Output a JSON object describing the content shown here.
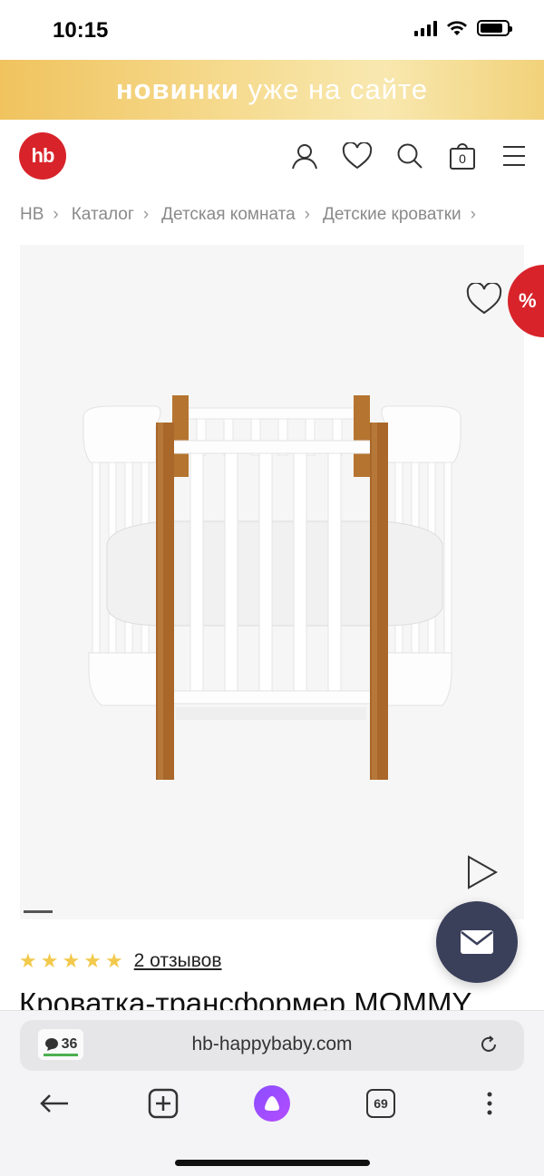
{
  "status": {
    "time": "10:15"
  },
  "promo": {
    "bold": "новинки",
    "rest": "уже на сайте"
  },
  "header": {
    "logo_text": "hb",
    "cart_count": "0"
  },
  "breadcrumb": [
    "HB",
    "Каталог",
    "Детская комната",
    "Детские кроватки"
  ],
  "product": {
    "sale_badge": "%",
    "rating": 5,
    "reviews_label": "2 отзывов",
    "title": "Кроватка-трансформер MOMMY"
  },
  "browser": {
    "tab_comments": "36",
    "url": "hb-happybaby.com",
    "tabs_count": "69"
  },
  "colors": {
    "brand": "#d8232a",
    "fab": "#3a3f5a",
    "star": "#f2c94c"
  }
}
